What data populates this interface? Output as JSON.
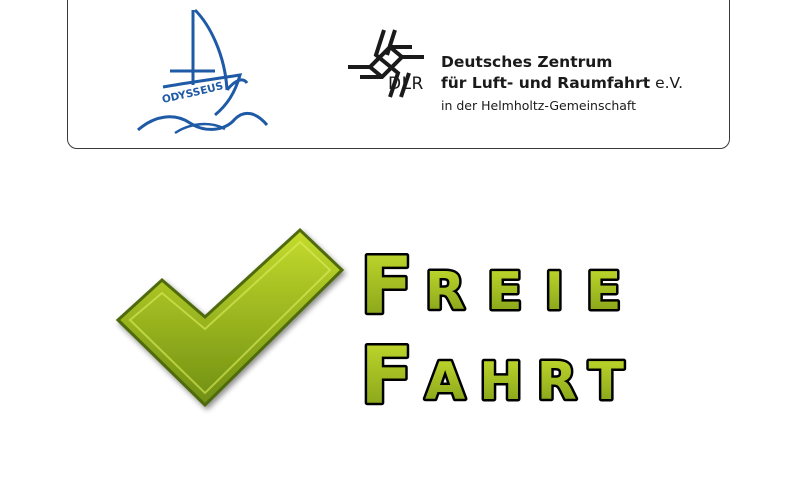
{
  "header": {
    "odysseus_logo_text": "ODYSSEUS",
    "dlr_abbreviation": "DLR",
    "dlr_name_line1": "Deutsches Zentrum",
    "dlr_name_line2": "für Luft- und Raumfahrt",
    "dlr_name_suffix": " e.V.",
    "dlr_name_line3": "in der Helmholtz-Gemeinschaft"
  },
  "banner": {
    "line1_initial": "F",
    "line1_rest": "REIE",
    "line2_initial": "F",
    "line2_rest": "AHRT"
  },
  "colors": {
    "banner_fill_light": "#c5dc2d",
    "banner_fill_dark": "#7e9c17",
    "banner_outline": "#000000",
    "odysseus_blue": "#1f5aa6"
  },
  "icons": {
    "checkmark": "checkmark-icon",
    "dlr_logo": "dlr-logo-icon",
    "odysseus_logo": "sailing-ship-icon"
  }
}
